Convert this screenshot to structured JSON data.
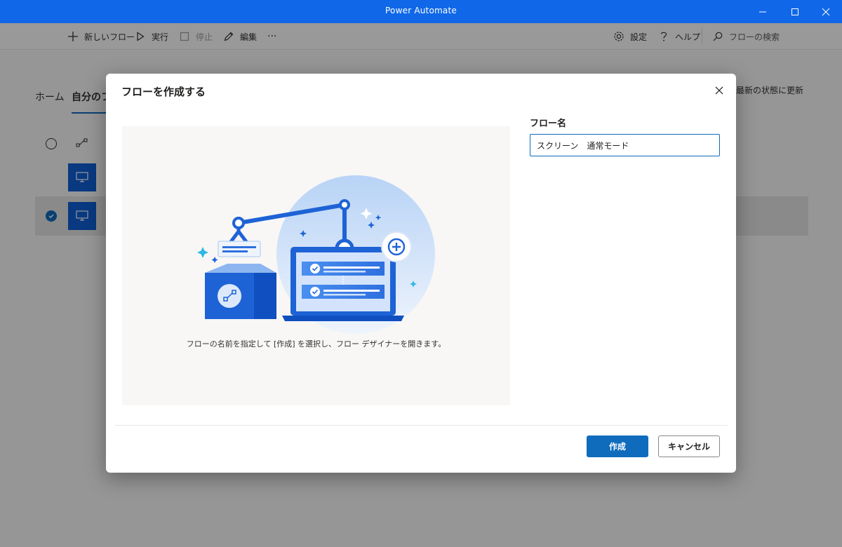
{
  "window": {
    "title": "Power Automate",
    "controls": [
      "minimize-icon",
      "maximize-icon",
      "close-icon"
    ]
  },
  "toolbar": {
    "new_flow": "新しいフロー",
    "run": "実行",
    "stop": "停止",
    "edit": "編集",
    "more": "···",
    "settings": "設定",
    "help": "ヘルプ",
    "search_placeholder": "フローの検索"
  },
  "page": {
    "tabs": [
      {
        "label": "ホーム",
        "active": false
      },
      {
        "label": "自分のフ",
        "active": true
      }
    ],
    "refresh": "最新の状態に更新"
  },
  "dialog": {
    "title": "フローを作成する",
    "caption": "フローの名前を指定して [作成] を選択し、フロー デザイナーを開きます。",
    "field_label": "フロー名",
    "field_value": "スクリーン　通常モード",
    "create_button": "作成",
    "cancel_button": "キャンセル"
  },
  "colors": {
    "accent": "#0f6cbd",
    "titlebar": "#1068e8"
  }
}
